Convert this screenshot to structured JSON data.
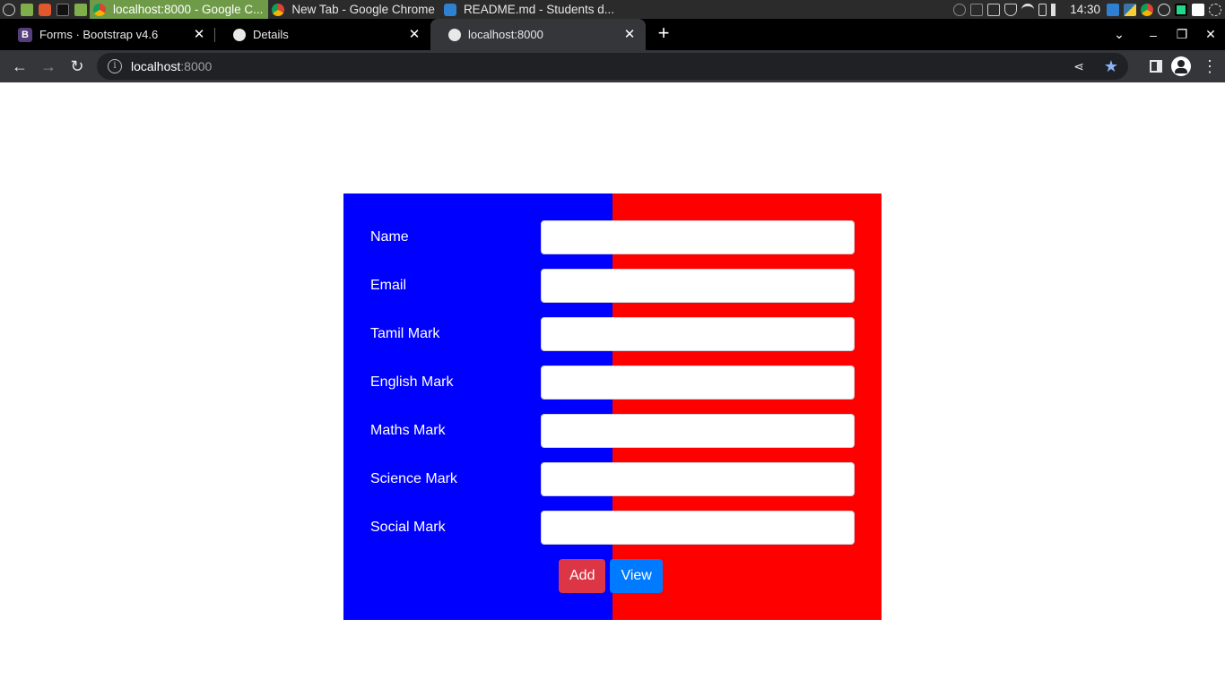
{
  "os_panel": {
    "tasks": [
      {
        "label": "localhost:8000 - Google C...",
        "active": true
      },
      {
        "label": "New Tab - Google Chrome",
        "active": false
      },
      {
        "label": "README.md - Students d...",
        "active": false
      }
    ],
    "clock": "14:30"
  },
  "browser": {
    "tabs": [
      {
        "title": "Forms · Bootstrap v4.6",
        "favicon": "B"
      },
      {
        "title": "Details",
        "favicon": ""
      },
      {
        "title": "localhost:8000",
        "favicon": ""
      }
    ],
    "url_host": "localhost",
    "url_port": ":8000"
  },
  "form": {
    "fields": [
      {
        "label": "Name",
        "value": ""
      },
      {
        "label": "Email",
        "value": ""
      },
      {
        "label": "Tamil Mark",
        "value": ""
      },
      {
        "label": "English Mark",
        "value": ""
      },
      {
        "label": "Maths Mark",
        "value": ""
      },
      {
        "label": "Science Mark",
        "value": ""
      },
      {
        "label": "Social Mark",
        "value": ""
      }
    ],
    "add_label": "Add",
    "view_label": "View"
  },
  "colors": {
    "left_panel": "#0000ff",
    "right_panel": "#ff0000",
    "add_button": "#dc3545",
    "view_button": "#007bff"
  }
}
